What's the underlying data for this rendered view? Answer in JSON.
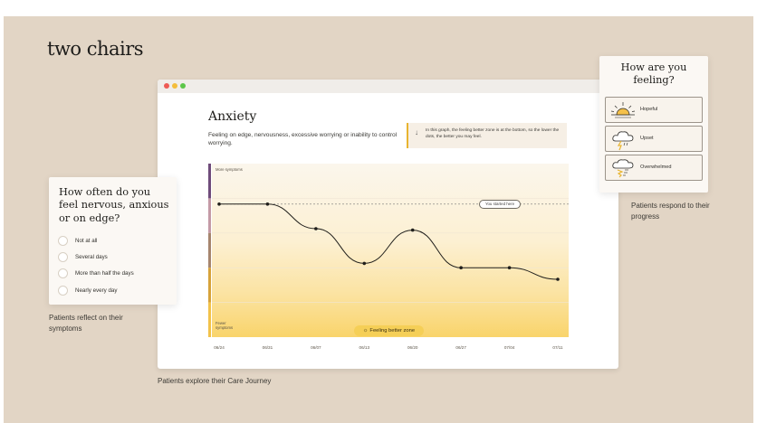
{
  "brand": {
    "logo": "two chairs"
  },
  "browser": {
    "title": "Anxiety",
    "description": "Feeling on edge, nervousness, excessive worrying or inability to control worrying.",
    "note": "In this graph, the feeling better zone is at the bottom, so the lower the dots, the better you may feel.",
    "more_symptoms": "More symptoms",
    "fewer_symptoms": "Fewer symptoms",
    "started_label": "You started here",
    "zone_label": "Feeling better zone",
    "window_dots": [
      "#ee5b55",
      "#f4bd3b",
      "#5cc649"
    ]
  },
  "chart_data": {
    "type": "line",
    "categories": [
      "06/24",
      "06/31",
      "06/07",
      "06/13",
      "06/20",
      "06/27",
      "07/04",
      "07/11"
    ],
    "values": [
      4.6,
      4.6,
      3.75,
      2.55,
      3.7,
      2.4,
      2.4,
      2.0
    ],
    "ylim": [
      0,
      6
    ],
    "baseline": 4.6,
    "grid": true,
    "zone_color": "#f5cf57",
    "side_bar_colors": [
      "#6f4b7a",
      "#c49aa6",
      "#a6856e",
      "#d6a23a",
      "#f2c24a"
    ]
  },
  "questionnaire": {
    "title": "How often do you feel nervous, anxious or on edge?",
    "options": [
      "Not at all",
      "Several days",
      "More than half the days",
      "Nearly every day"
    ]
  },
  "feelings": {
    "title": "How are you feeling?",
    "options": [
      {
        "label": "Hopeful",
        "icon": "sunrise-icon"
      },
      {
        "label": "Upset",
        "icon": "storm-cloud-icon"
      },
      {
        "label": "Overwhelmed",
        "icon": "tornado-cloud-icon"
      }
    ]
  },
  "captions": {
    "reflect": "Patients reflect on their symptoms",
    "explore": "Patients explore their Care Journey",
    "respond": "Patients respond to their progress"
  },
  "colors": {
    "background": "#e2d5c5",
    "card": "#fbf8f4",
    "accent": "#e8b430"
  }
}
